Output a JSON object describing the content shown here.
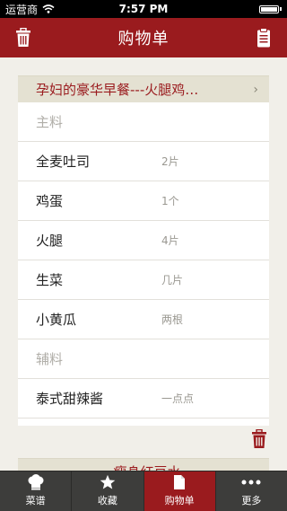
{
  "status": {
    "carrier": "运营商",
    "time": "7:57 PM"
  },
  "nav": {
    "title": "购物单",
    "left_icon": "trash-icon",
    "right_icon": "clipboard-icon"
  },
  "colors": {
    "accent": "#9a1b1e",
    "tabbar": "#3d3d3b",
    "background": "#f1efe9"
  },
  "card1": {
    "title": "孕妇的豪华早餐---火腿鸡…",
    "sections": [
      {
        "label": "主料",
        "items": [
          {
            "name": "全麦吐司",
            "qty": "2片"
          },
          {
            "name": "鸡蛋",
            "qty": "1个"
          },
          {
            "name": "火腿",
            "qty": "4片"
          },
          {
            "name": "生菜",
            "qty": "几片"
          },
          {
            "name": "小黄瓜",
            "qty": "两根"
          }
        ]
      },
      {
        "label": "辅料",
        "items": [
          {
            "name": "泰式甜辣酱",
            "qty": "一点点"
          }
        ]
      }
    ]
  },
  "card2": {
    "title": "瘦身红豆水"
  },
  "tabs": [
    {
      "label": "菜谱",
      "icon": "chef-hat-icon",
      "active": false
    },
    {
      "label": "收藏",
      "icon": "star-icon",
      "active": false
    },
    {
      "label": "购物单",
      "icon": "document-icon",
      "active": true
    },
    {
      "label": "更多",
      "icon": "more-icon",
      "active": false
    }
  ]
}
